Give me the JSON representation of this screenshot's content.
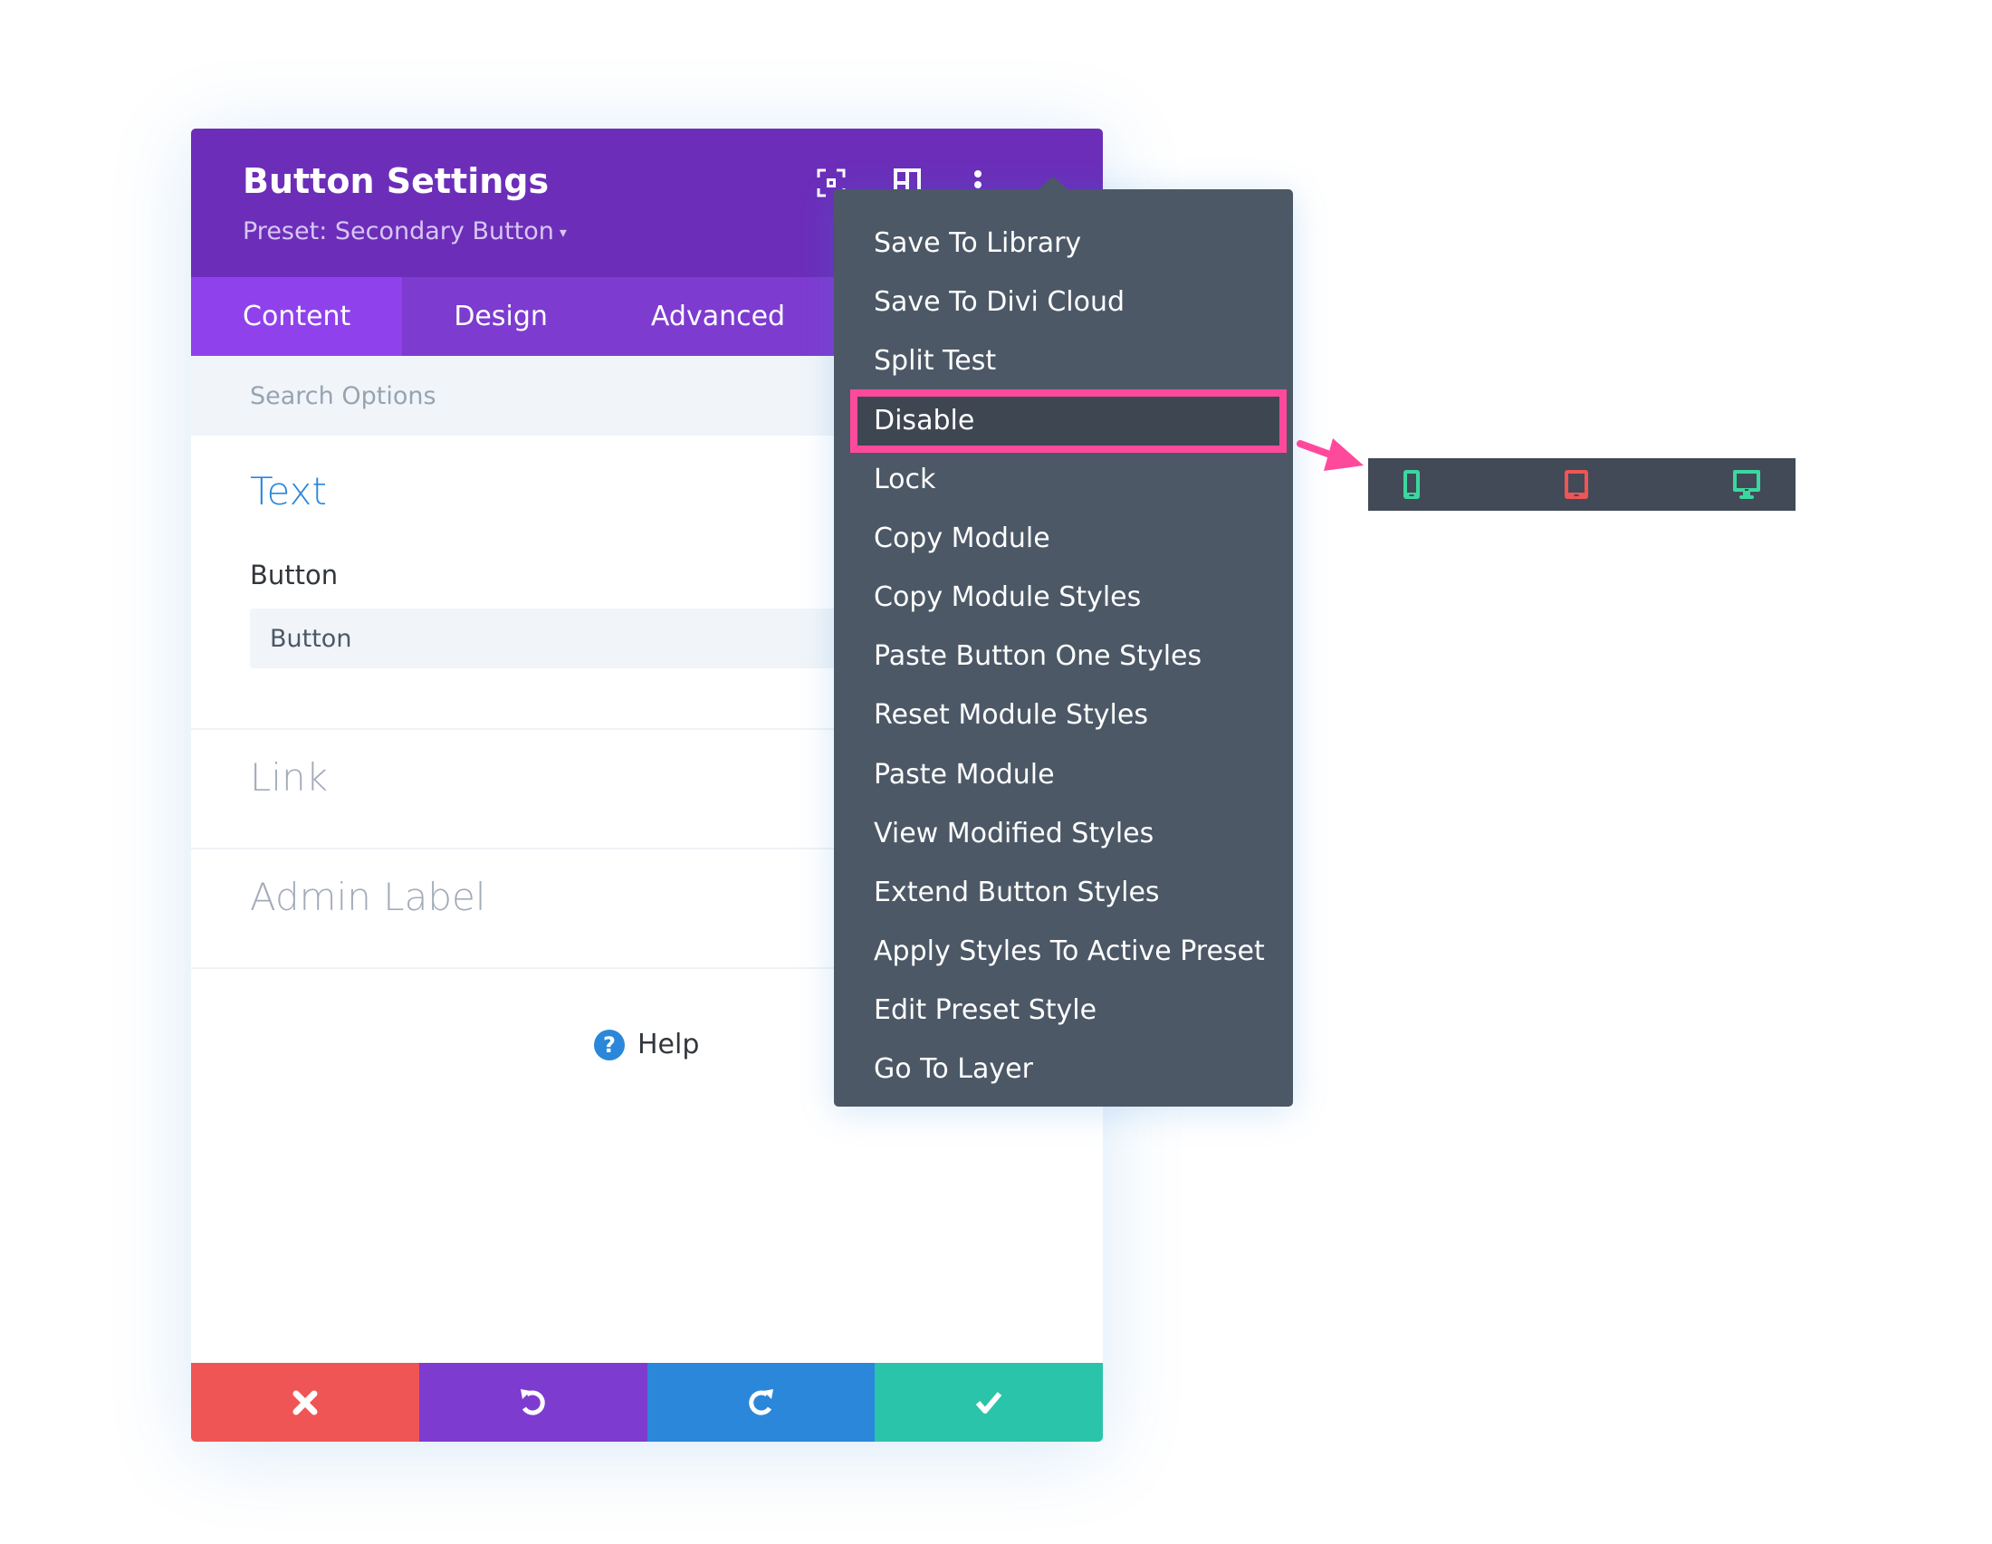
{
  "panel": {
    "title": "Button Settings",
    "preset_label": "Preset: Secondary Button",
    "preset_caret": "▾",
    "header_icons": [
      "fullscreen-icon",
      "sidebar-layout-icon",
      "more-options-icon"
    ],
    "tabs": [
      {
        "label": "Content",
        "active": true
      },
      {
        "label": "Design",
        "active": false
      },
      {
        "label": "Advanced",
        "active": false
      }
    ],
    "search_placeholder": "Search Options",
    "sections": {
      "text": {
        "title": "Text",
        "field_label": "Button",
        "field_value": "Button"
      },
      "link": {
        "title": "Link"
      },
      "admin_label": {
        "title": "Admin Label"
      }
    },
    "help": {
      "icon": "?",
      "label": "Help"
    },
    "footer": [
      {
        "name": "discard",
        "icon": "close-icon",
        "color": "#ef5555"
      },
      {
        "name": "undo",
        "icon": "undo-icon",
        "color": "#7e3bd0"
      },
      {
        "name": "redo",
        "icon": "redo-icon",
        "color": "#2b87da"
      },
      {
        "name": "save",
        "icon": "check-icon",
        "color": "#29c4a9"
      }
    ]
  },
  "context_menu": {
    "items": [
      {
        "label": "Save To Library"
      },
      {
        "label": "Save To Divi Cloud"
      },
      {
        "label": "Split Test"
      },
      {
        "label": "Disable",
        "highlighted": true
      },
      {
        "label": "Lock"
      },
      {
        "label": "Copy Module"
      },
      {
        "label": "Copy Module Styles"
      },
      {
        "label": "Paste Button One Styles"
      },
      {
        "label": "Reset Module Styles"
      },
      {
        "label": "Paste Module"
      },
      {
        "label": "View Modified Styles"
      },
      {
        "label": "Extend Button Styles"
      },
      {
        "label": "Apply Styles To Active Preset"
      },
      {
        "label": "Edit Preset Style"
      },
      {
        "label": "Go To Layer"
      }
    ]
  },
  "device_bar": {
    "devices": [
      {
        "name": "phone",
        "icon": "phone-icon",
        "color": "#3cd7a0",
        "disabled": false
      },
      {
        "name": "tablet",
        "icon": "tablet-icon",
        "color": "#ef5555",
        "disabled": true
      },
      {
        "name": "desktop",
        "icon": "desktop-icon",
        "color": "#3cd7a0",
        "disabled": false
      }
    ]
  },
  "colors": {
    "header": "#6c2eb9",
    "tabs": "#7e3bd0",
    "tab_active": "#8f42ec",
    "menu_bg": "#4c5866",
    "highlight_border": "#ff4a9c",
    "accent_blue": "#2b87da"
  }
}
